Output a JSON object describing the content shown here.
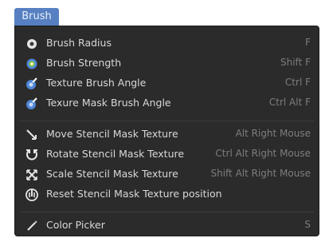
{
  "menu_header": "Brush",
  "sections": [
    {
      "items": [
        {
          "label": "Brush Radius",
          "underline": "R",
          "shortcut": "F",
          "icon": "radius-dot-icon"
        },
        {
          "label": "Brush Strength",
          "underline": "S",
          "shortcut": "Shift F",
          "icon": "strength-dot-icon"
        },
        {
          "label": "Texture Brush Angle",
          "underline": "T",
          "shortcut": "Ctrl F",
          "icon": "texture-angle-icon"
        },
        {
          "label": "Texure Mask Brush Angle",
          "underline": "M",
          "shortcut": "Ctrl Alt F",
          "icon": "mask-angle-icon"
        }
      ]
    },
    {
      "items": [
        {
          "label": "Move Stencil Mask Texture",
          "underline": "v",
          "shortcut": "Alt Right Mouse",
          "icon": "move-stencil-icon"
        },
        {
          "label": "Rotate Stencil Mask Texture",
          "underline": "R",
          "shortcut": "Ctrl Alt Right Mouse",
          "icon": "rotate-stencil-icon"
        },
        {
          "label": "Scale Stencil Mask Texture",
          "underline": "a",
          "shortcut": "Shift Alt Right Mouse",
          "icon": "scale-stencil-icon"
        },
        {
          "label": "Reset Stencil Mask Texture position",
          "underline": "p",
          "shortcut": "",
          "icon": "reset-stencil-icon"
        }
      ]
    },
    {
      "items": [
        {
          "label": "Color Picker",
          "underline": "C",
          "shortcut": "S",
          "icon": "color-picker-icon"
        }
      ]
    }
  ]
}
